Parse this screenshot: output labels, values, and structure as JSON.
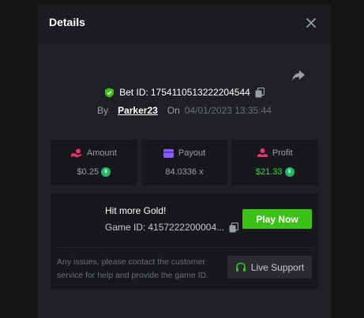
{
  "modal": {
    "title": "Details"
  },
  "bet": {
    "label": "Bet ID:",
    "id": "1754110513222204544",
    "by_label": "By",
    "user": "Parker23",
    "on_label": "On",
    "datetime": "04/01/2023 13:35:44"
  },
  "stats": [
    {
      "label": "Amount",
      "value": "$0.25",
      "icon": "hand-coin-icon",
      "color": "#e0356b"
    },
    {
      "label": "Payout",
      "value": "84.0336 x",
      "icon": "wallet-icon",
      "color": "#8a5cff"
    },
    {
      "label": "Profit",
      "value": "$21.33",
      "icon": "profit-icon",
      "color": "#e0356b"
    }
  ],
  "game": {
    "promo": "Hit more Gold!",
    "id_label": "Game ID:",
    "id_value": "4157222200004...",
    "play_label": "Play Now"
  },
  "support": {
    "help_text": "Any issues, please contact the customer service for help and provide the game ID.",
    "button_label": "Live Support"
  },
  "colors": {
    "accent_green": "#3bc117",
    "profit_green": "#3fd63d"
  }
}
